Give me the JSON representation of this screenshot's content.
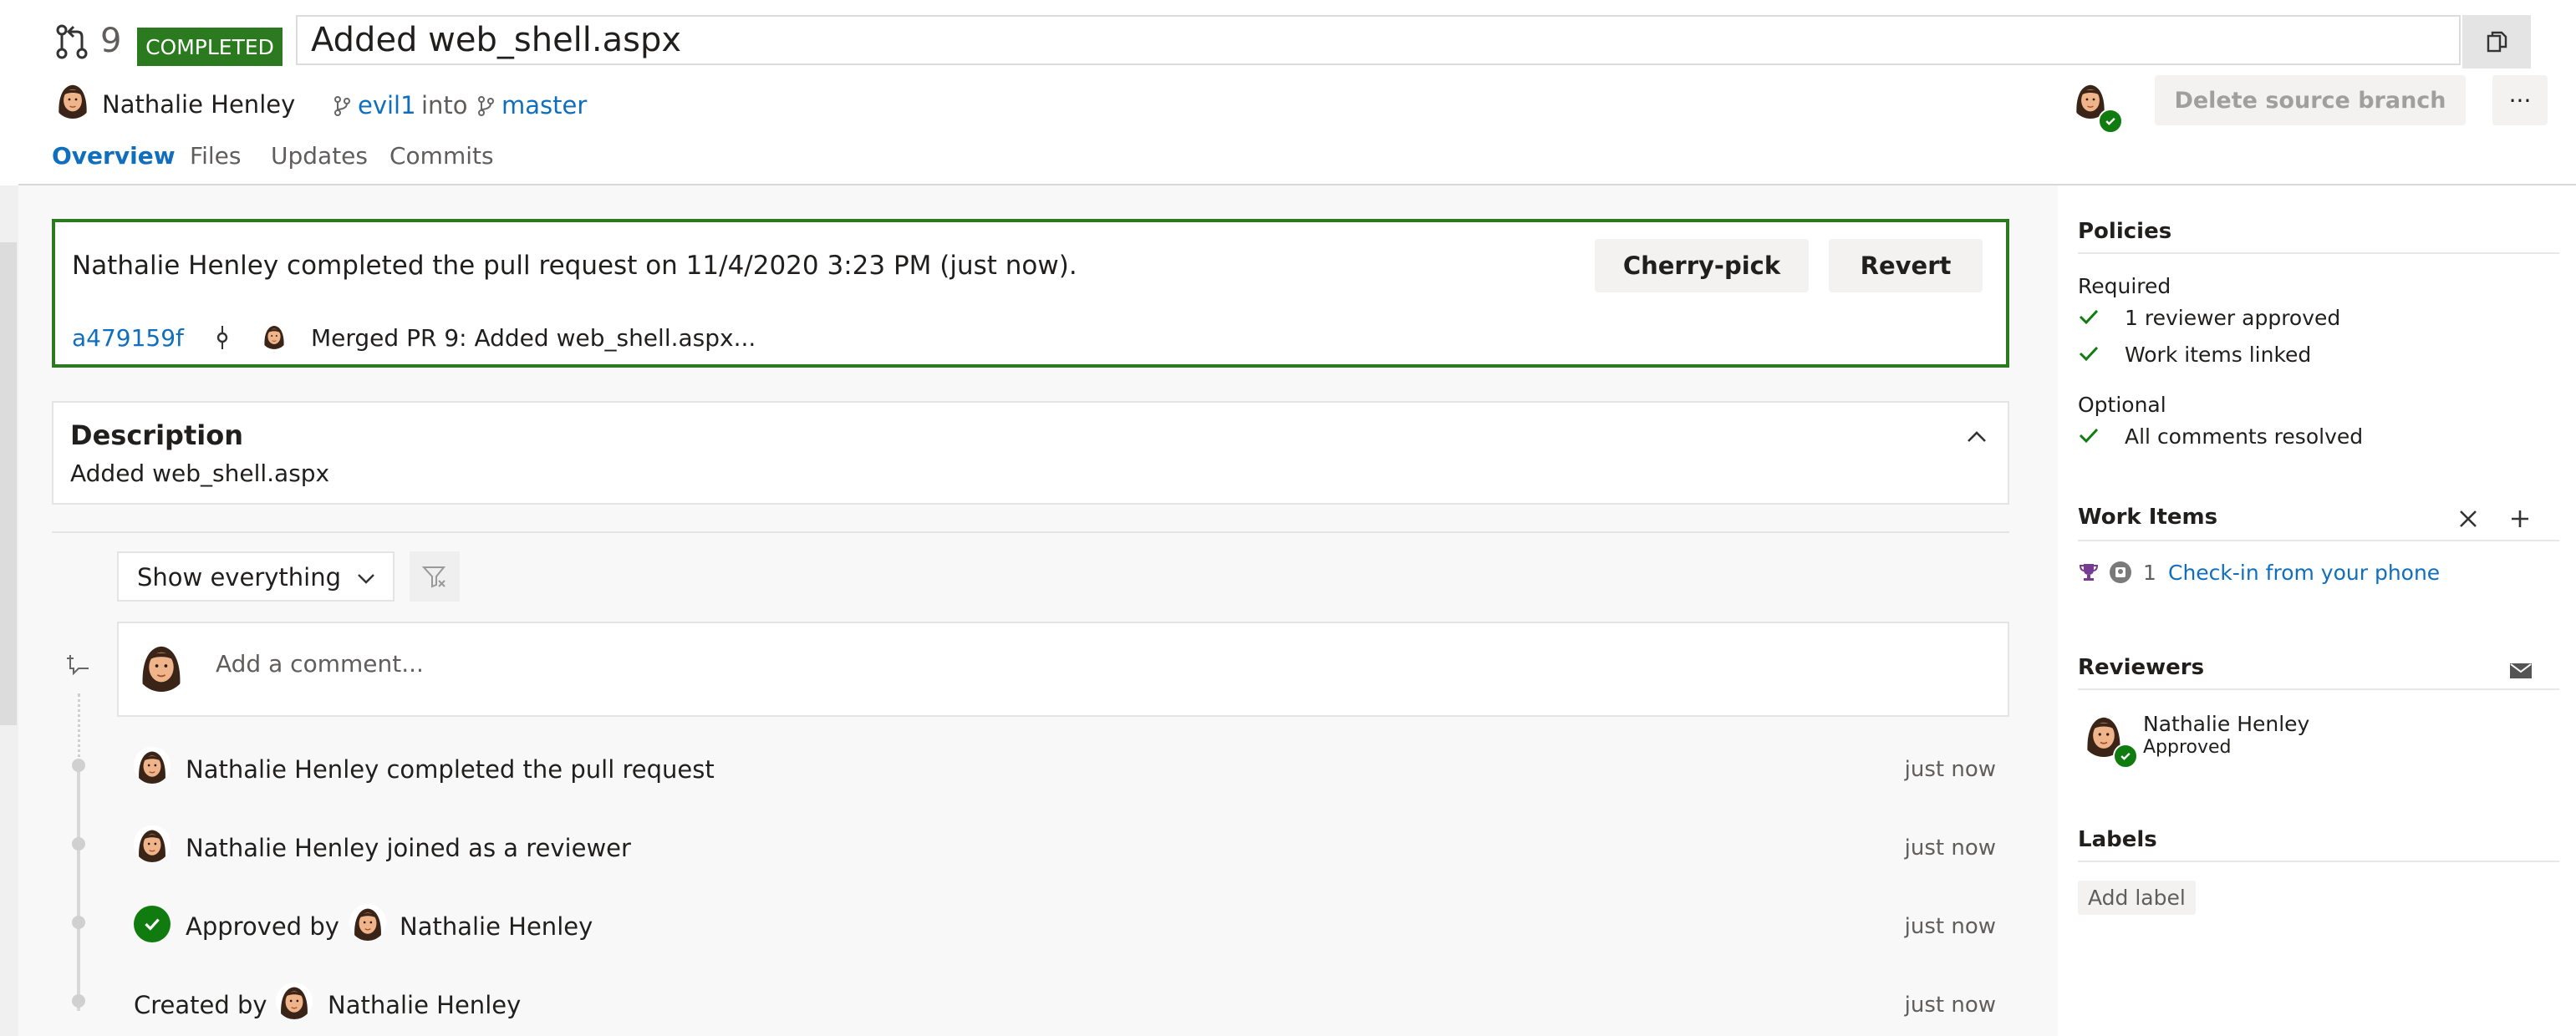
{
  "header": {
    "pr_number": "9",
    "status_badge": "COMPLETED",
    "title": "Added web_shell.aspx",
    "author": "Nathalie Henley",
    "source_branch": "evil1",
    "into_text": "into",
    "target_branch": "master",
    "delete_branch_label": "Delete source branch",
    "more_label": "···"
  },
  "tabs": [
    "Overview",
    "Files",
    "Updates",
    "Commits"
  ],
  "completion": {
    "message": "Nathalie Henley completed the pull request on 11/4/2020 3:23 PM (just now).",
    "cherry_pick_label": "Cherry-pick",
    "revert_label": "Revert",
    "commit_id": "a479159f",
    "commit_message": "Merged PR 9: Added web_shell.aspx..."
  },
  "description": {
    "heading": "Description",
    "text": "Added web_shell.aspx"
  },
  "activity": {
    "filter_label": "Show everything",
    "comment_placeholder": "Add a comment...",
    "items": [
      {
        "pre": "",
        "text": "Nathalie Henley completed the pull request",
        "time": "just now"
      },
      {
        "pre": "",
        "text": "Nathalie Henley joined as a reviewer",
        "time": "just now"
      },
      {
        "pre": "Approved by",
        "text": "Nathalie Henley",
        "time": "just now"
      },
      {
        "pre": "Created by",
        "text": "Nathalie Henley",
        "time": "just now"
      }
    ]
  },
  "sidebar": {
    "policies_heading": "Policies",
    "required_label": "Required",
    "required_items": [
      "1 reviewer approved",
      "Work items linked"
    ],
    "optional_label": "Optional",
    "optional_items": [
      "All comments resolved"
    ],
    "work_items_heading": "Work Items",
    "work_item": {
      "id": "1",
      "title": "Check-in from your phone"
    },
    "reviewers_heading": "Reviewers",
    "reviewer": {
      "name": "Nathalie Henley",
      "status": "Approved"
    },
    "labels_heading": "Labels",
    "add_label": "Add label"
  },
  "colors": {
    "accent": "#106ebe",
    "success": "#107c10",
    "completed_badge": "#2b7a1f",
    "panel_border": "#2b7a1f",
    "activity_bg": "#f8f8f8"
  },
  "icons": {
    "pr": "pull-request-icon",
    "copy": "copy-icon",
    "branch": "branch-icon",
    "commit": "commit-icon",
    "chevron_up": "chevron-up-icon",
    "chevron_down": "chevron-down-icon",
    "filter": "filter-icon",
    "comment": "comment-icon",
    "check": "check-icon",
    "close": "close-icon",
    "add": "add-icon",
    "trophy": "trophy-icon",
    "work_item": "work-item-icon",
    "mail": "mail-icon"
  }
}
